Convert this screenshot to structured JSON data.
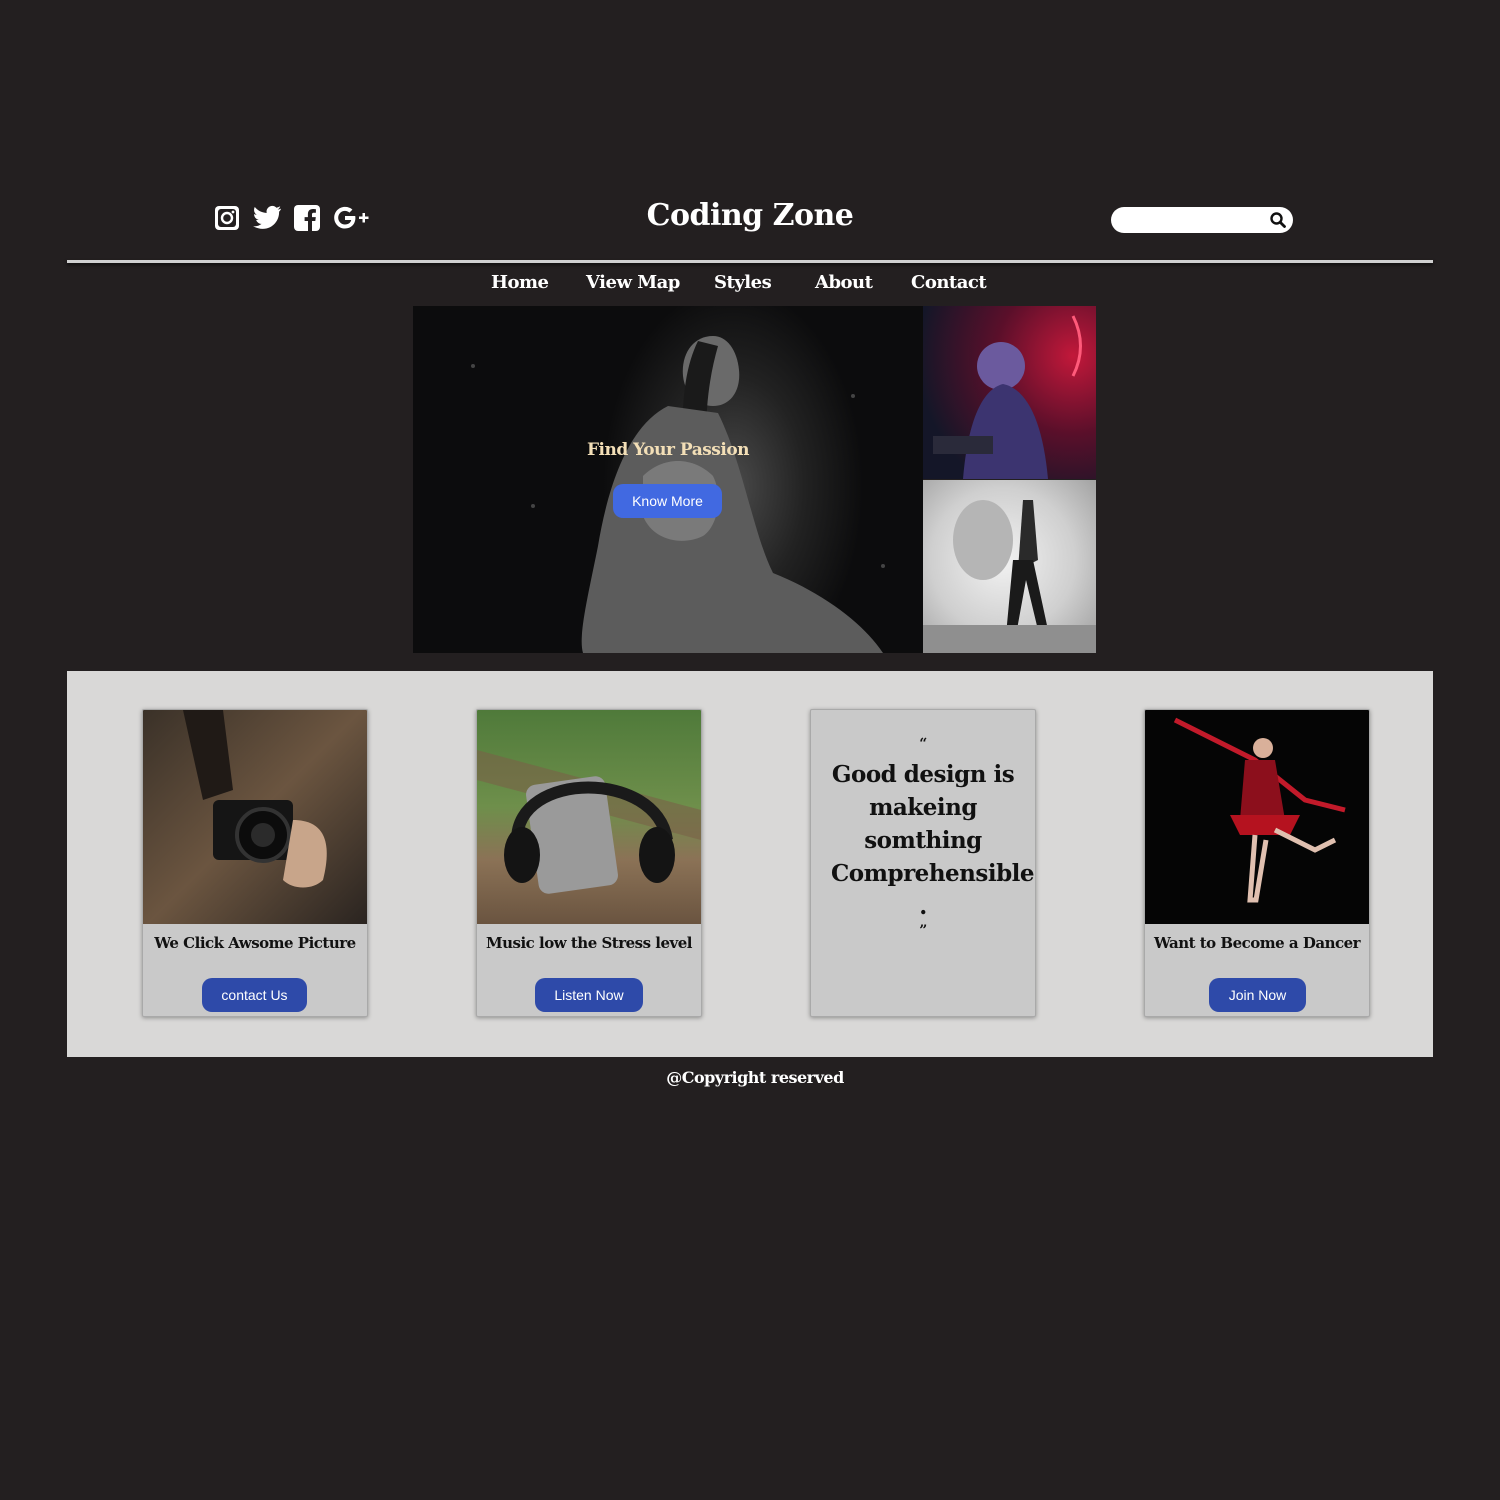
{
  "header": {
    "brand": "Coding Zone",
    "social": [
      "instagram-icon",
      "twitter-icon",
      "facebook-icon",
      "google-plus-icon"
    ],
    "search": {
      "value": "",
      "placeholder": ""
    }
  },
  "nav": [
    "Home",
    "View Map",
    "Styles",
    "About",
    "Contact"
  ],
  "hero": {
    "title": "Find Your Passion",
    "button": "Know More"
  },
  "cards": [
    {
      "title": "We Click Awsome Picture",
      "button": "contact Us"
    },
    {
      "title": "Music low the Stress level",
      "button": "Listen Now"
    },
    {
      "quote_open": "“",
      "quote": "Good design is makeing somthing Comprehensible .",
      "quote_close": "”"
    },
    {
      "title": "Want to Become a Dancer",
      "button": "Join Now"
    }
  ],
  "footer": {
    "copyright": "@Copyright reserved"
  },
  "colors": {
    "background": "#231f20",
    "hero_button": "#4169e1",
    "card_button": "#2e4aa9",
    "band": "#d9d8d7"
  }
}
